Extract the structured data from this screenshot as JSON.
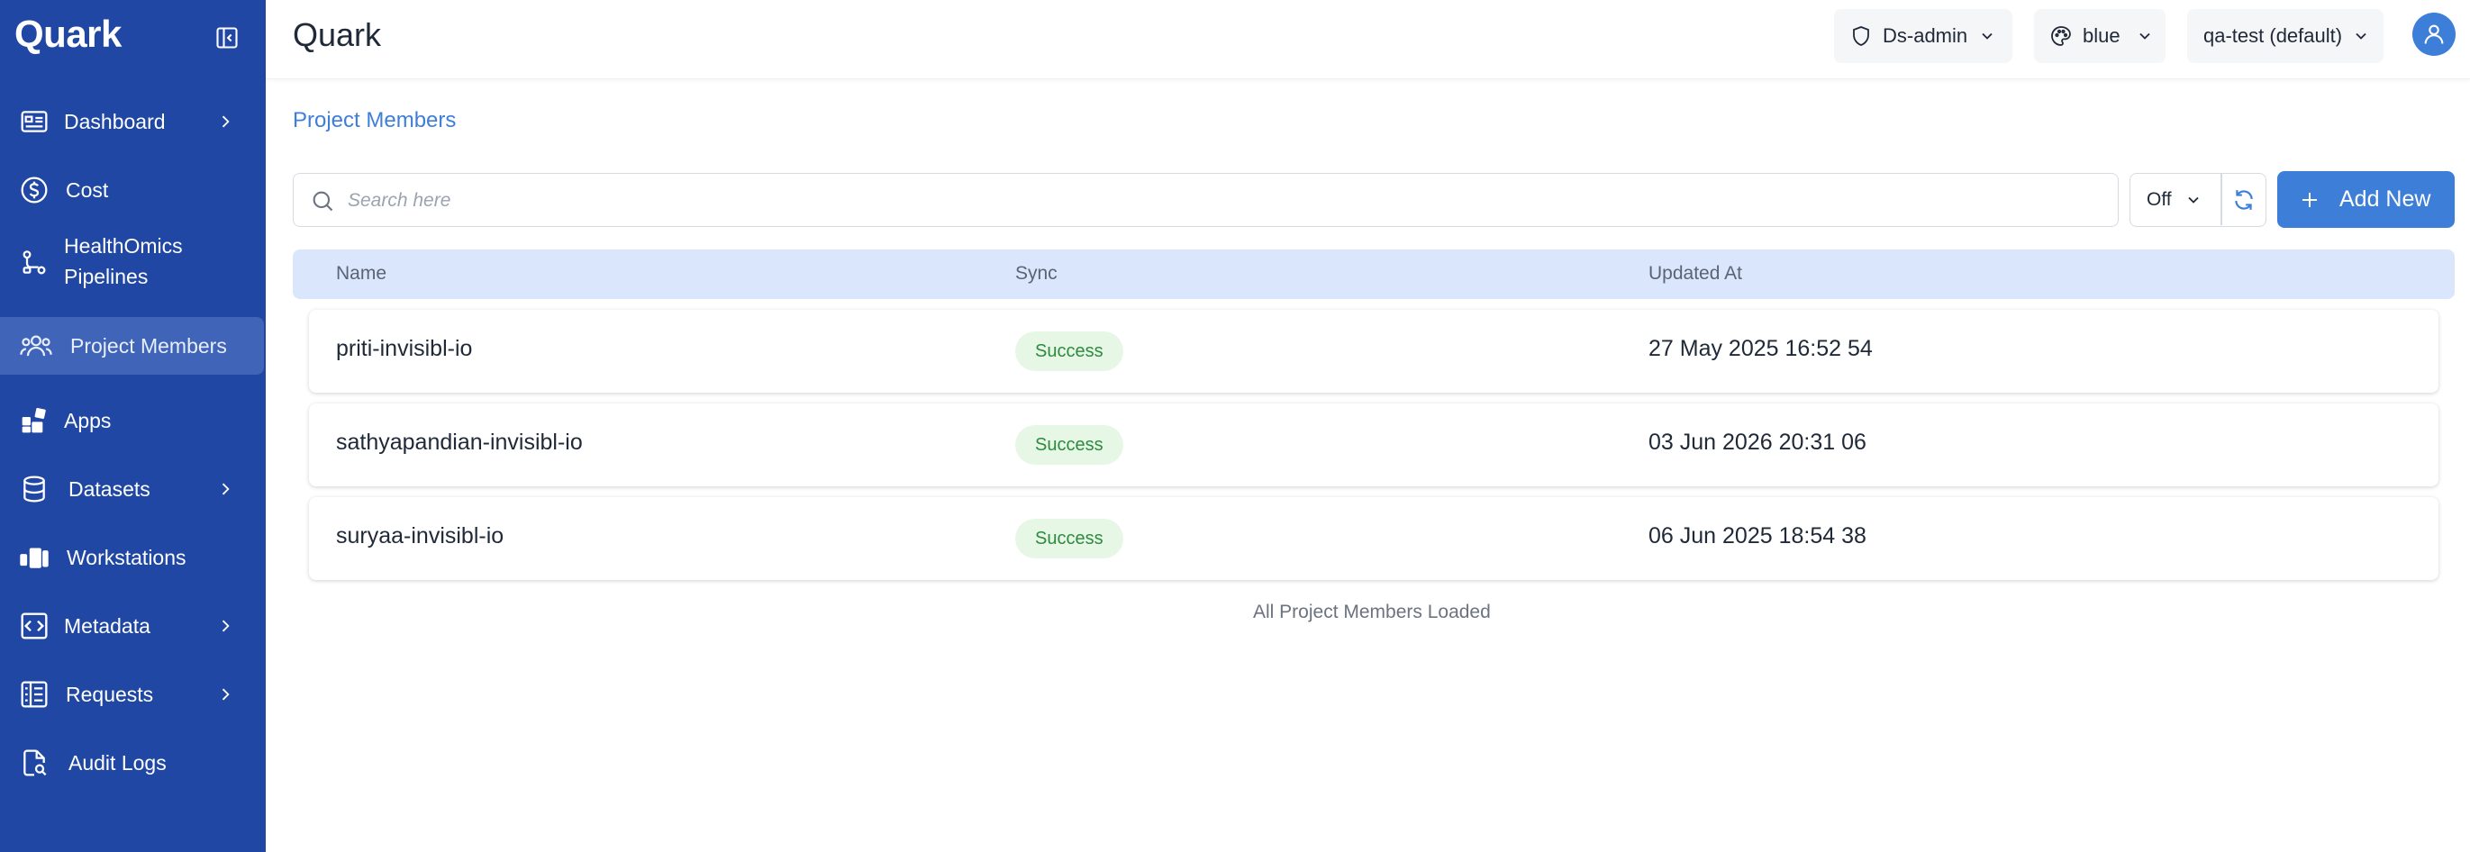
{
  "app": {
    "brand": "Quark",
    "page_heading": "Quark"
  },
  "sidebar": {
    "items": [
      {
        "label": "Dashboard",
        "icon": "dashboard-icon",
        "has_submenu": true
      },
      {
        "label": "Cost",
        "icon": "dollar-icon",
        "has_submenu": false
      },
      {
        "label": "HealthOmics Pipelines",
        "label_line1": "HealthOmics",
        "label_line2": "Pipelines",
        "icon": "pipeline-icon",
        "has_submenu": false
      },
      {
        "label": "Project Members",
        "icon": "users-icon",
        "has_submenu": false,
        "active": true
      },
      {
        "label": "Apps",
        "icon": "apps-icon",
        "has_submenu": false
      },
      {
        "label": "Datasets",
        "icon": "database-icon",
        "has_submenu": true
      },
      {
        "label": "Workstations",
        "icon": "workstation-icon",
        "has_submenu": false
      },
      {
        "label": "Metadata",
        "icon": "code-icon",
        "has_submenu": true
      },
      {
        "label": "Requests",
        "icon": "requests-icon",
        "has_submenu": true
      },
      {
        "label": "Audit Logs",
        "icon": "audit-icon",
        "has_submenu": false
      }
    ]
  },
  "header": {
    "role": "Ds-admin",
    "theme": "blue",
    "workspace": "qa-test (default)"
  },
  "main": {
    "breadcrumb": "Project Members",
    "search": {
      "placeholder": "Search here",
      "value": ""
    },
    "sync_filter": "Off",
    "add_button": "Add New",
    "columns": [
      "Name",
      "Sync",
      "Updated At"
    ],
    "rows": [
      {
        "name": "priti-invisibl-io",
        "sync": "Success",
        "updated_at": "27 May 2025 16:52 54"
      },
      {
        "name": "sathyapandian-invisibl-io",
        "sync": "Success",
        "updated_at": "03 Jun 2026 20:31 06"
      },
      {
        "name": "suryaa-invisibl-io",
        "sync": "Success",
        "updated_at": "06 Jun 2025 18:54 38"
      }
    ],
    "footer": "All Project Members Loaded"
  },
  "colors": {
    "sidebar_bg": "#1f47a3",
    "sidebar_active": "#3f64b8",
    "accent": "#3d7fd8",
    "table_header": "#d9e6fb",
    "success_bg": "#e6f7e6",
    "success_text": "#2f8a3e"
  }
}
